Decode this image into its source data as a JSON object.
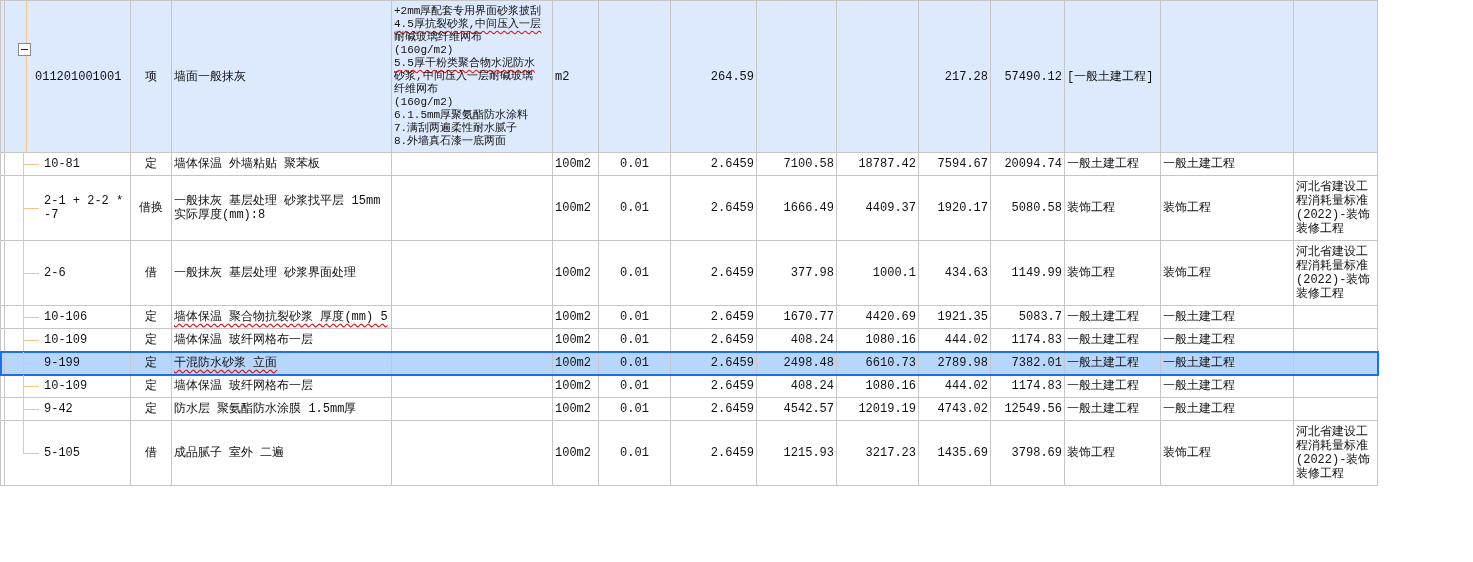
{
  "table": {
    "rows": [
      {
        "kind": "parent",
        "expanded": true,
        "selected": false,
        "code": "011201001001",
        "type": "项",
        "name": "墙面一般抹灰",
        "name_underlined": false,
        "description_lines": [
          {
            "text": "+2mm厚配套专用界面砂浆披刮",
            "underlined": false
          },
          {
            "text": "4.5厚抗裂砂浆,中间压入一层",
            "underlined": true
          },
          {
            "text": "耐碱玻璃纤维网布",
            "underlined": false
          },
          {
            "text": "(160g/m2)",
            "underlined": false
          },
          {
            "text": "5.5厚干粉类聚合物水泥防水",
            "underlined": true
          },
          {
            "text": "砂浆,中间压入一层耐碱玻璃",
            "underlined": false
          },
          {
            "text": "纤维网布",
            "underlined": false
          },
          {
            "text": "(160g/m2)",
            "underlined": false
          },
          {
            "text": "6.1.5mm厚聚氨酯防水涂料",
            "underlined": false
          },
          {
            "text": "7.满刮两遍柔性耐水腻子",
            "underlined": false
          },
          {
            "text": "8.外墙真石漆一底两面",
            "underlined": false
          }
        ],
        "unit": "m2",
        "column_7": "",
        "column_8": "264.59",
        "column_9": "",
        "column_10": "",
        "column_11": "217.28",
        "column_12": "57490.12",
        "column_13": "[一般土建工程]",
        "column_14": "",
        "column_15": ""
      },
      {
        "kind": "child",
        "selected": false,
        "code": "10-81",
        "type": "定",
        "name": "墙体保温 外墙粘贴 聚苯板",
        "name_underlined": false,
        "unit": "100m2",
        "column_7": "0.01",
        "column_8": "2.6459",
        "column_9": "7100.58",
        "column_10": "18787.42",
        "column_11": "7594.67",
        "column_12": "20094.74",
        "column_13": "一般土建工程",
        "column_14": "一般土建工程",
        "column_15": ""
      },
      {
        "kind": "child",
        "selected": false,
        "code": "2-1 + 2-2 *\n-7",
        "type": "借换",
        "name": "一般抹灰 基层处理 砂浆找平层 15mm\n实际厚度(mm):8",
        "name_underlined": false,
        "unit": "100m2",
        "column_7": "0.01",
        "column_8": "2.6459",
        "column_9": "1666.49",
        "column_10": "4409.37",
        "column_11": "1920.17",
        "column_12": "5080.58",
        "column_13": "装饰工程",
        "column_14": "装饰工程",
        "column_15": "河北省建设工程消耗量标准(2022)-装饰装修工程"
      },
      {
        "kind": "child",
        "selected": false,
        "code": "2-6",
        "type": "借",
        "name": "一般抹灰 基层处理 砂浆界面处理",
        "name_underlined": false,
        "unit": "100m2",
        "column_7": "0.01",
        "column_8": "2.6459",
        "column_9": "377.98",
        "column_10": "1000.1",
        "column_11": "434.63",
        "column_12": "1149.99",
        "column_13": "装饰工程",
        "column_14": "装饰工程",
        "column_15": "河北省建设工程消耗量标准(2022)-装饰装修工程"
      },
      {
        "kind": "child",
        "selected": false,
        "code": "10-106",
        "type": "定",
        "name": "墙体保温 聚合物抗裂砂浆 厚度(mm) 5",
        "name_underlined": true,
        "unit": "100m2",
        "column_7": "0.01",
        "column_8": "2.6459",
        "column_9": "1670.77",
        "column_10": "4420.69",
        "column_11": "1921.35",
        "column_12": "5083.7",
        "column_13": "一般土建工程",
        "column_14": "一般土建工程",
        "column_15": ""
      },
      {
        "kind": "child",
        "selected": false,
        "code": "10-109",
        "type": "定",
        "name": "墙体保温 玻纤网格布一层",
        "name_underlined": false,
        "unit": "100m2",
        "column_7": "0.01",
        "column_8": "2.6459",
        "column_9": "408.24",
        "column_10": "1080.16",
        "column_11": "444.02",
        "column_12": "1174.83",
        "column_13": "一般土建工程",
        "column_14": "一般土建工程",
        "column_15": ""
      },
      {
        "kind": "child",
        "selected": true,
        "code": "9-199",
        "type": "定",
        "name": "干混防水砂浆 立面",
        "name_underlined": true,
        "unit": "100m2",
        "column_7": "0.01",
        "column_8": "2.6459",
        "column_9": "2498.48",
        "column_10": "6610.73",
        "column_11": "2789.98",
        "column_12": "7382.01",
        "column_13": "一般土建工程",
        "column_14": "一般土建工程",
        "column_15": ""
      },
      {
        "kind": "child",
        "selected": false,
        "code": "10-109",
        "type": "定",
        "name": "墙体保温 玻纤网格布一层",
        "name_underlined": false,
        "unit": "100m2",
        "column_7": "0.01",
        "column_8": "2.6459",
        "column_9": "408.24",
        "column_10": "1080.16",
        "column_11": "444.02",
        "column_12": "1174.83",
        "column_13": "一般土建工程",
        "column_14": "一般土建工程",
        "column_15": ""
      },
      {
        "kind": "child",
        "selected": false,
        "code": "9-42",
        "type": "定",
        "name": "防水层 聚氨酯防水涂膜 1.5mm厚",
        "name_underlined": false,
        "unit": "100m2",
        "column_7": "0.01",
        "column_8": "2.6459",
        "column_9": "4542.57",
        "column_10": "12019.19",
        "column_11": "4743.02",
        "column_12": "12549.56",
        "column_13": "一般土建工程",
        "column_14": "一般土建工程",
        "column_15": ""
      },
      {
        "kind": "child",
        "selected": false,
        "code": "5-105",
        "type": "借",
        "name": "成品腻子 室外 二遍",
        "name_underlined": false,
        "unit": "100m2",
        "column_7": "0.01",
        "column_8": "2.6459",
        "column_9": "1215.93",
        "column_10": "3217.23",
        "column_11": "1435.69",
        "column_12": "3798.69",
        "column_13": "装饰工程",
        "column_14": "装饰工程",
        "column_15": "河北省建设工程消耗量标准(2022)-装饰装修工程"
      }
    ]
  }
}
